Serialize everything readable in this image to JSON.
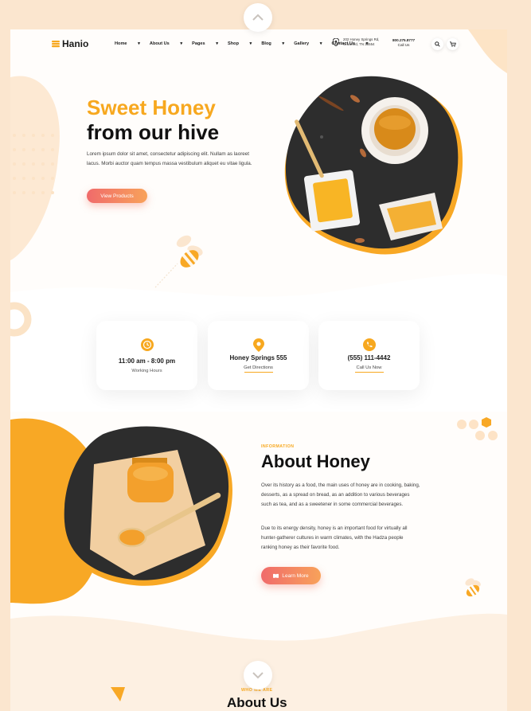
{
  "brand": {
    "name": "Hanio"
  },
  "nav": {
    "items": [
      "Home",
      "About Us",
      "Pages",
      "Shop",
      "Blog",
      "Gallery",
      "Contact Us"
    ],
    "address_line1": "202 Honey Springs Rd,",
    "address_line2": "Crawford, TN 38554",
    "phone": "800.275.8777",
    "call_label": "Call Us"
  },
  "hero": {
    "title_line1": "Sweet Honey",
    "title_line2": "from our hive",
    "text": "Lorem ipsum dolor sit amet, consectetur adipiscing elit. Nullam as laoreet lacus. Morbi auctor quam tempus massa vestibulum aliquet eu vitae ligula.",
    "button": "View Products"
  },
  "info_cards": [
    {
      "main": "11:00 am - 8:00 pm",
      "sub": "Working Hours",
      "icon": "clock-icon"
    },
    {
      "main": "Honey Springs 555",
      "sub": "Get Directions",
      "icon": "location-icon"
    },
    {
      "main": "(555) 111-4442",
      "sub": "Call Us Now",
      "icon": "phone-icon"
    }
  ],
  "about": {
    "label": "INFORMATION",
    "title": "About Honey",
    "p1": "Over its history as a food, the main uses of honey are in cooking, baking, desserts, as a spread on bread, as an addition to various beverages such as tea, and as a sweetener in some commercial beverages.",
    "p2": "Due to its energy density, honey is an important food for virtually all hunter-gatherer cultures in warm climates, with the Hadza people ranking honey as their favorite food.",
    "button": "Learn More"
  },
  "next_section": {
    "label": "WHO WE ARE",
    "title": "About Us"
  },
  "colors": {
    "accent": "#f7a81f",
    "button_start": "#f06b6b",
    "button_end": "#f8a25a",
    "background": "#fbe6cf"
  }
}
